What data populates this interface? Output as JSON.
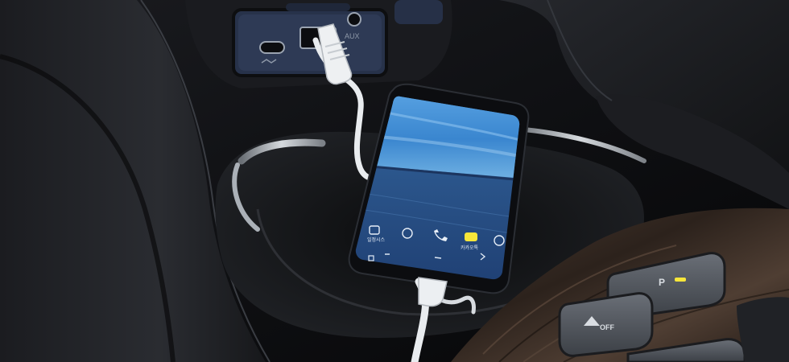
{
  "scene": {
    "description_id": "car-center-console-phone-charging",
    "colors": {
      "console_dark": "#141518",
      "console_mid": "#24262b",
      "trim_silver": "#b9bec4",
      "wood_trim": "#3a2c24",
      "cable_white": "#e9ecef",
      "phone_sky": "#3f8fd3",
      "phone_ground": "#2a4f8a",
      "button_gray": "#4b4f56",
      "indicator_yellow": "#f7e63a"
    }
  },
  "usb_panel": {
    "aux_label": "AUX"
  },
  "phone": {
    "dock_labels": [
      "일정시스",
      "",
      "",
      "카카오톡",
      ""
    ],
    "icons": [
      "calendar-icon",
      "chat-icon",
      "phone-icon",
      "kakao-icon",
      "globe-icon"
    ]
  },
  "console_buttons": {
    "parking_assist_label": "P",
    "hill_descent_label": "OFF"
  }
}
